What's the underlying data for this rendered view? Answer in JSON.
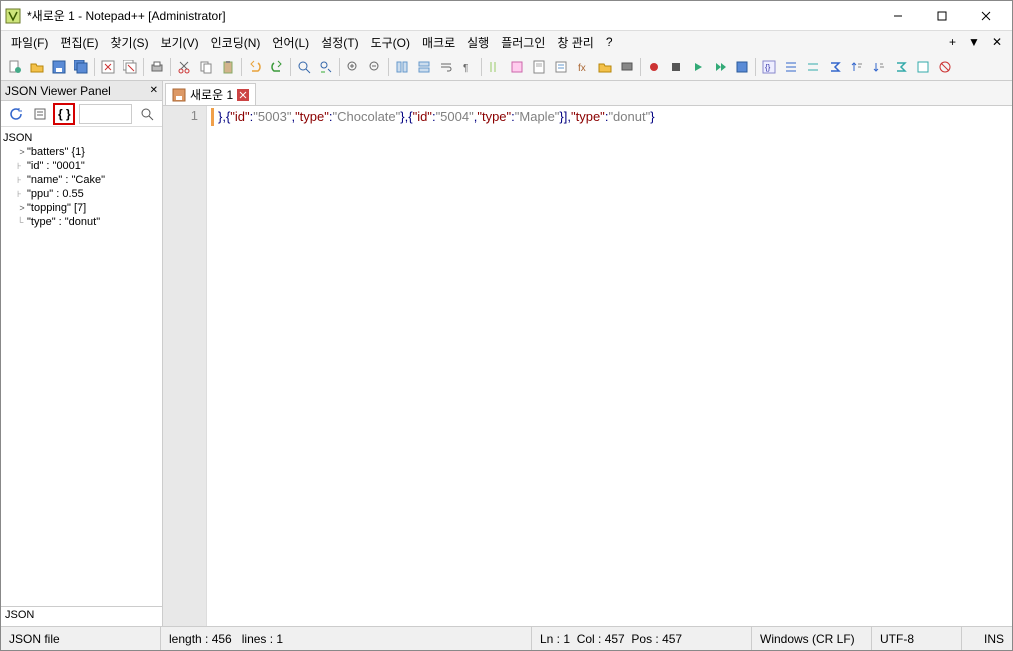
{
  "titlebar": {
    "title": "*새로운 1 - Notepad++ [Administrator]"
  },
  "menu": {
    "items": [
      "파일(F)",
      "편집(E)",
      "찾기(S)",
      "보기(V)",
      "인코딩(N)",
      "언어(L)",
      "설정(T)",
      "도구(O)",
      "매크로",
      "실행",
      "플러그인",
      "창 관리",
      "?"
    ],
    "plus": "+",
    "down": "▼",
    "close": "✕"
  },
  "json_panel": {
    "title": "JSON Viewer Panel",
    "root": "JSON",
    "nodes": [
      {
        "exp": ">",
        "label": "\"batters\" {1}"
      },
      {
        "exp": "",
        "label": "\"id\" : \"0001\""
      },
      {
        "exp": "",
        "label": "\"name\" : \"Cake\""
      },
      {
        "exp": "",
        "label": "\"ppu\" : 0.55"
      },
      {
        "exp": ">",
        "label": "\"topping\" [7]"
      },
      {
        "exp": "",
        "label": "\"type\" : \"donut\""
      }
    ],
    "bottom": "JSON"
  },
  "editor": {
    "tab_label": "새로운 1",
    "line_number": "1",
    "code_segments": [
      {
        "cls": "op",
        "t": "},{"
      },
      {
        "cls": "key",
        "t": "\"id\""
      },
      {
        "cls": "op",
        "t": ":"
      },
      {
        "cls": "str",
        "t": "\"5003\""
      },
      {
        "cls": "op",
        "t": ","
      },
      {
        "cls": "key",
        "t": "\"type\""
      },
      {
        "cls": "op",
        "t": ":"
      },
      {
        "cls": "str",
        "t": "\"Chocolate\""
      },
      {
        "cls": "op",
        "t": "},{"
      },
      {
        "cls": "key",
        "t": "\"id\""
      },
      {
        "cls": "op",
        "t": ":"
      },
      {
        "cls": "str",
        "t": "\"5004\""
      },
      {
        "cls": "op",
        "t": ","
      },
      {
        "cls": "key",
        "t": "\"type\""
      },
      {
        "cls": "op",
        "t": ":"
      },
      {
        "cls": "str",
        "t": "\"Maple\""
      },
      {
        "cls": "op",
        "t": "}],"
      },
      {
        "cls": "key",
        "t": "\"type\""
      },
      {
        "cls": "op",
        "t": ":"
      },
      {
        "cls": "str",
        "t": "\"donut\""
      },
      {
        "cls": "op",
        "t": "}"
      }
    ]
  },
  "status": {
    "filetype": "JSON file",
    "length": "length : 456",
    "lines": "lines : 1",
    "ln": "Ln : 1",
    "col": "Col : 457",
    "pos": "Pos : 457",
    "eol": "Windows (CR LF)",
    "enc": "UTF-8",
    "ins": "INS"
  }
}
